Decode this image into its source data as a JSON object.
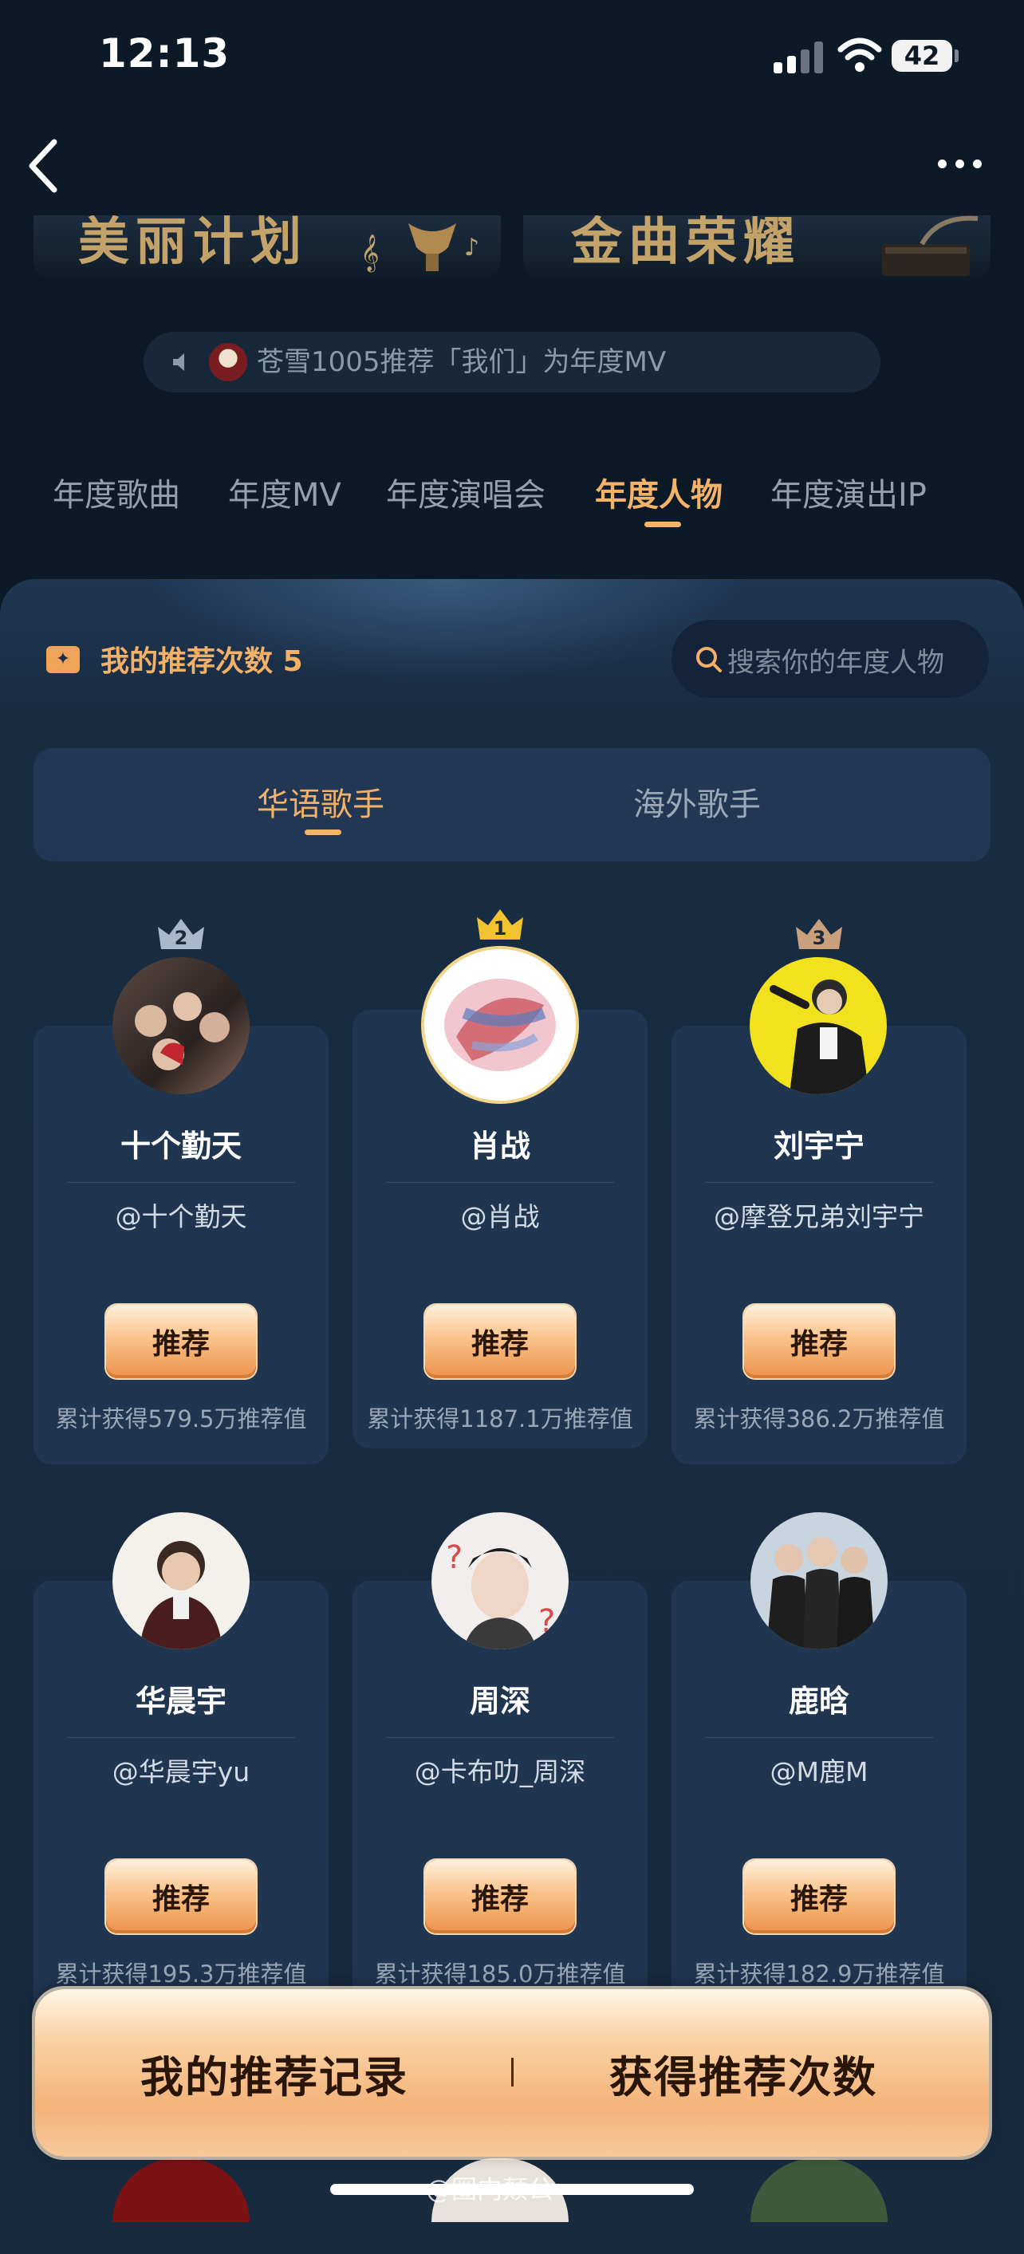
{
  "status_bar": {
    "time": "12:13",
    "battery": "42"
  },
  "banners": [
    "美丽计划",
    "金曲荣耀"
  ],
  "broadcast": {
    "text": "苍雪1005推荐「我们」为年度MV"
  },
  "category_tabs": [
    "年度歌曲",
    "年度MV",
    "年度演唱会",
    "年度人物",
    "年度演出IP"
  ],
  "active_category": "年度人物",
  "recommend_count": {
    "label": "我的推荐次数",
    "value": "5"
  },
  "search": {
    "placeholder": "搜索你的年度人物"
  },
  "sub_tabs": [
    "华语歌手",
    "海外歌手"
  ],
  "cards": [
    {
      "rank": "2",
      "name": "十个勤天",
      "handle": "@十个勤天",
      "button": "推荐",
      "total": "累计获得579.5万推荐值"
    },
    {
      "rank": "1",
      "name": "肖战",
      "handle": "@肖战",
      "button": "推荐",
      "total": "累计获得1187.1万推荐值"
    },
    {
      "rank": "3",
      "name": "刘宇宁",
      "handle": "@摩登兄弟刘宇宁",
      "button": "推荐",
      "total": "累计获得386.2万推荐值"
    },
    {
      "name": "华晨宇",
      "handle": "@华晨宇yu",
      "button": "推荐",
      "total": "累计获得195.3万推荐值"
    },
    {
      "name": "周深",
      "handle": "@卡布叻_周深",
      "button": "推荐",
      "total": "累计获得185.0万推荐值"
    },
    {
      "name": "鹿晗",
      "handle": "@M鹿M",
      "button": "推荐",
      "total": "累计获得182.9万推荐值"
    }
  ],
  "bottom_bar": {
    "left": "我的推荐记录",
    "right": "获得推荐次数"
  },
  "watermark": "@圈内颠公",
  "colors": {
    "accent": "#f5b36a",
    "background": "#0c1a27",
    "card": "#1f3550",
    "crown_gold": "#f2c230",
    "crown_silver": "#a9b9cc",
    "crown_bronze": "#c9a07c"
  }
}
